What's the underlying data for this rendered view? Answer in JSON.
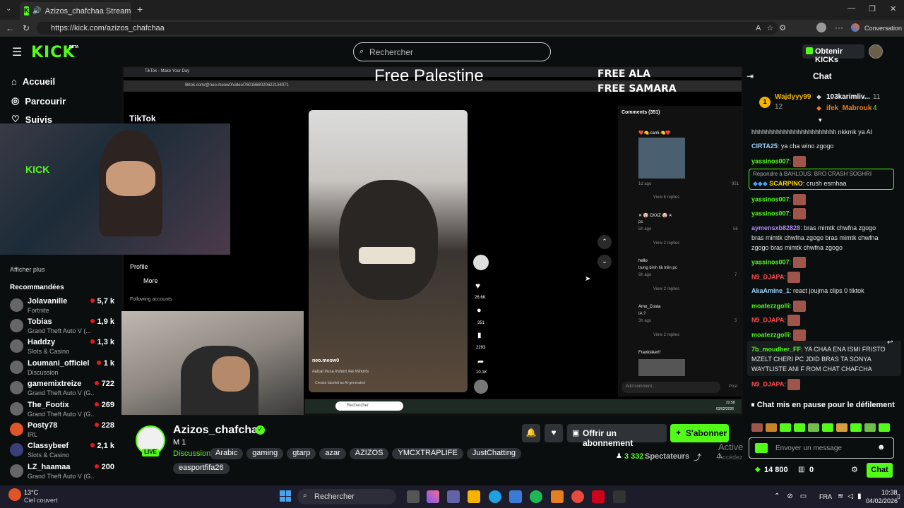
{
  "browser": {
    "tab_title": "Azizos_chafchaa Stream - Wa",
    "url": "https://kick.com/azizos_chafchaa",
    "conversation_label": "Conversation"
  },
  "header": {
    "logo": "KICK",
    "logo_badge": "BETA",
    "search_placeholder": "Rechercher",
    "get_kicks": "Obtenir KICKs"
  },
  "sidebar": {
    "nav": [
      {
        "label": "Accueil",
        "icon": "home-icon"
      },
      {
        "label": "Parcourir",
        "icon": "compass-icon"
      },
      {
        "label": "Suivis",
        "icon": "heart-icon"
      }
    ],
    "show_more": "Afficher plus",
    "recommended_title": "Recommandées",
    "recommended": [
      {
        "name": "Jolavanille",
        "category": "Fortnite",
        "viewers": "5,7 k"
      },
      {
        "name": "Tobias",
        "category": "Grand Theft Auto V (...",
        "viewers": "1,9 k"
      },
      {
        "name": "Haddzy",
        "category": "Slots & Casino",
        "viewers": "1,3 k"
      },
      {
        "name": "Loumani_officiel",
        "category": "Discussion",
        "viewers": "1 k"
      },
      {
        "name": "gamemixtreize",
        "category": "Grand Theft Auto V (G...",
        "viewers": "722"
      },
      {
        "name": "The_Footix",
        "category": "Grand Theft Auto V (G...",
        "viewers": "269"
      },
      {
        "name": "Posty78",
        "category": "IRL",
        "viewers": "228"
      },
      {
        "name": "Classybeef",
        "category": "Slots & Casino",
        "viewers": "2,1 k"
      },
      {
        "name": "LZ_haamaa",
        "category": "Grand Theft Auto V (G...",
        "viewers": "200"
      }
    ]
  },
  "video": {
    "overlay_title": "Free Palestine",
    "overlay_right1": "FREE ALA",
    "overlay_right2": "FREE SAMARA",
    "tiktok_tab": "TikTok - Make Your Day",
    "tiktok_url": "tiktok.com/@neo.meow0/video/7601868020622134071",
    "tiktok_logo": "TikTok",
    "tiktok_author": "neo.meow0",
    "tiktok_caption": "#aicat #usa #short #ai #shorts",
    "tiktok_ai_label": "Creator labeled as AI-generated",
    "tiktok_profile": "Profile",
    "tiktok_more": "More",
    "following_accounts": "Following accounts",
    "likes": "26.6K",
    "comments_count": "351",
    "saves": "2293",
    "shares": "10.1K",
    "comments_title": "Comments (351)",
    "comments": [
      {
        "user": "❤️🍋.cami.🍋❤️",
        "text": "",
        "time": "1d ago",
        "likes": "951",
        "replies": "View 6 replies"
      },
      {
        "user": "✕ 🤡 CKXZ 🤡 ✕",
        "text": "pc",
        "time": "5h ago",
        "likes": "56",
        "replies": "View 2 replies"
      },
      {
        "user": "hello",
        "text": "trung bình tik trên pc",
        "time": "6h ago",
        "likes": "7",
        "replies": "View 2 replies"
      },
      {
        "user": "Amo_Costa",
        "text": "IA ?",
        "time": "3h ago",
        "likes": "5",
        "replies": "View 2 replies"
      },
      {
        "user": "Franksiker!!",
        "text": "",
        "time": "",
        "likes": "",
        "replies": ""
      }
    ],
    "add_comment": "Add comment...",
    "post": "Post",
    "inner_search": "Rechercher",
    "inner_time": "22:58",
    "inner_date": "03/02/2026"
  },
  "channel": {
    "name": "Azizos_chafchaa",
    "subtitle": "M 1",
    "live": "LIVE",
    "category": "Discussion",
    "tags": [
      "Arabic",
      "gaming",
      "gtarp",
      "azar",
      "AZIZOS",
      "YMCXTRAPLIFE",
      "JustChatting",
      "easportfifa26"
    ],
    "gift_sub": "Offrir un abonnement",
    "subscribe": "S'abonner",
    "viewers": "3 332",
    "viewers_label": "Spectateurs",
    "activate_windows1": "Activer Windows",
    "activate_windows2": "Accédez aux paramètres pour activer Windows."
  },
  "chat": {
    "title": "Chat",
    "top_gifters": [
      {
        "name": "Wajdyyy99",
        "count": "12"
      },
      {
        "name": "103karimliv...",
        "count": "11"
      },
      {
        "name": "ifek_Mabrouk",
        "count": "4"
      }
    ],
    "messages": [
      {
        "user": "",
        "text": "hhhhhhhhhhhhhhhhhhhhhhhh nkkmk ya AI",
        "color": "#e6e6e6"
      },
      {
        "user": "CIRTA25",
        "text": "ya cha wino zgogo",
        "color": "#9bd4ff"
      },
      {
        "user": "yassinos007",
        "text": "",
        "color": "#53fc18",
        "emote": true
      },
      {
        "user": "SCARPINO",
        "text": "crush esmhaa",
        "color": "#ffd700",
        "reply": "Répondre à BAHLOUS: BRO CRASH SOGHRI"
      },
      {
        "user": "yassinos007",
        "text": "",
        "color": "#53fc18",
        "emote": true
      },
      {
        "user": "yassinos007",
        "text": "",
        "color": "#53fc18",
        "emote": true
      },
      {
        "user": "aymensxb82828",
        "text": "bras mimtk chwfna zgogo bras mimtk chwfna zgogo bras mimtk chwfna zgogo bras mimtk chwfna zgogo",
        "color": "#b388ff"
      },
      {
        "user": "yassinos007",
        "text": "",
        "color": "#53fc18",
        "emote": true
      },
      {
        "user": "N9_DJAPA",
        "text": "",
        "color": "#ff4d4d",
        "emote": true
      },
      {
        "user": "AkaAmine_1",
        "text": "react joujma clips 0 tiktok",
        "color": "#9bd4ff"
      },
      {
        "user": "moatezzgolli",
        "text": "",
        "color": "#53fc18",
        "emote": true
      },
      {
        "user": "N9_DJAPA",
        "text": "",
        "color": "#ff4d4d",
        "emote": true
      },
      {
        "user": "moatezzgolli",
        "text": "",
        "color": "#53fc18",
        "emote": true
      },
      {
        "user": "7b_moudher_FF",
        "text": "YA CHAA ENA ISMI FRISTO MZELT CHERI PC JDID BRAS TA SONYA WAYTLISTE ANI F ROM CHAT CHAFCHA",
        "color": "#53fc18"
      },
      {
        "user": "N9_DJAPA",
        "text": "",
        "color": "#ff4d4d",
        "emote": true
      }
    ],
    "paused": "Chat mis en pause pour le défilement",
    "input_placeholder": "Envoyer un message",
    "kicks_balance": "14 800",
    "other_count": "0",
    "send_label": "Chat"
  },
  "taskbar": {
    "weather_temp": "13°C",
    "weather_desc": "Ciel couvert",
    "search": "Rechercher",
    "lang": "FRA",
    "time": "10:38",
    "date": "04/02/2026"
  },
  "colors": {
    "accent": "#53fc18",
    "bg": "#0b0e0f",
    "live": "#e91916"
  }
}
